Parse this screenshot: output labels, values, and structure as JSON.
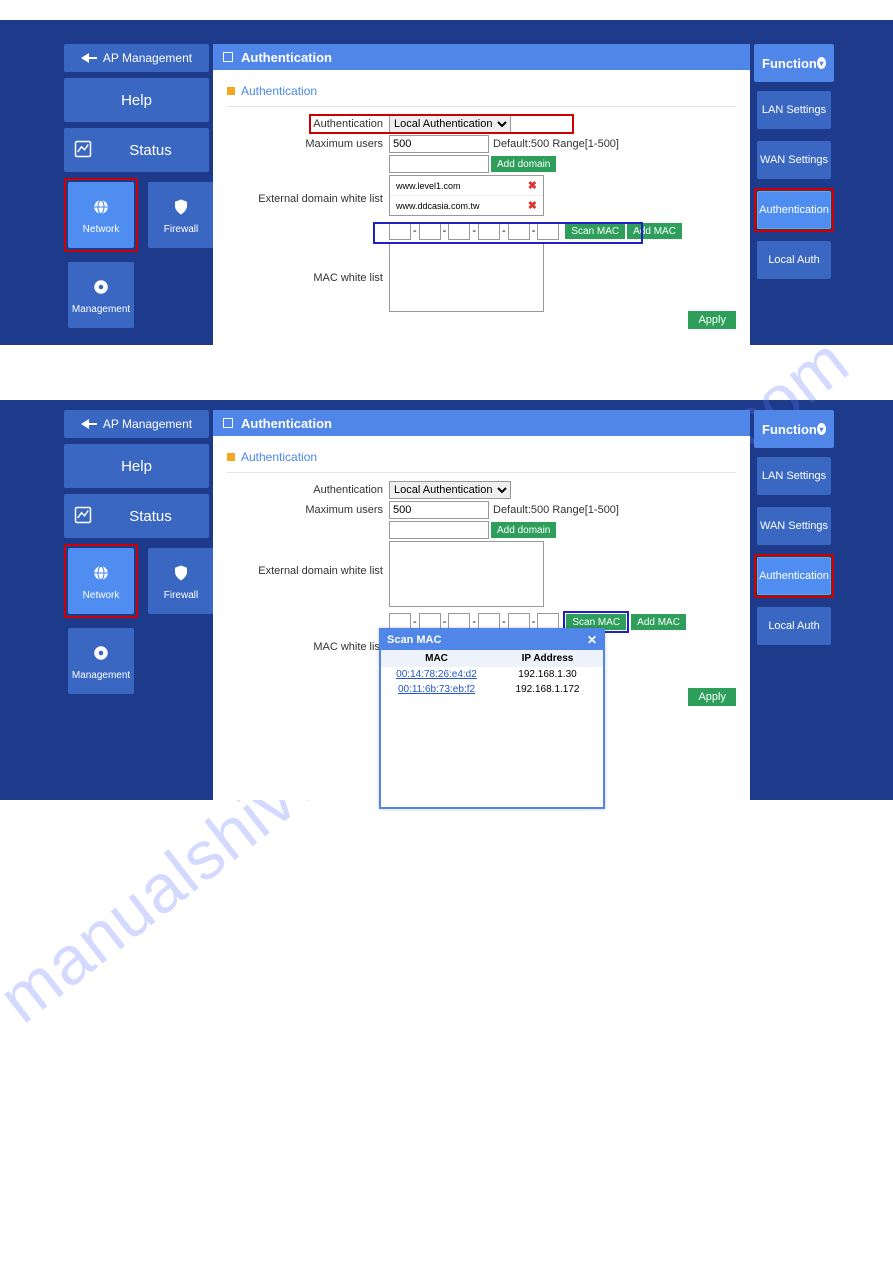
{
  "watermark": "manualshive.com",
  "left": {
    "ap_mgmt": "AP Management",
    "help": "Help",
    "status": "Status",
    "network": "Network",
    "firewall": "Firewall",
    "management": "Management"
  },
  "right": {
    "function": "Function",
    "lan": "LAN Settings",
    "wan": "WAN Settings",
    "auth": "Authentication",
    "local_auth": "Local Auth"
  },
  "title": "Authentication",
  "section": "Authentication",
  "form": {
    "lbl_auth": "Authentication",
    "sel_auth": "Local Authentication",
    "lbl_max": "Maximum users",
    "val_max": "500",
    "hint_max": "Default:500 Range[1-500]",
    "btn_add_domain": "Add domain",
    "lbl_whitelist": "External domain white list",
    "domain1": "www.level1.com",
    "domain2": "www.ddcasia.com.tw",
    "btn_scan": "Scan MAC",
    "btn_addmac": "Add MAC",
    "lbl_macwl": "MAC white list",
    "btn_apply": "Apply"
  },
  "popup": {
    "title": "Scan MAC",
    "col_mac": "MAC",
    "col_ip": "IP Address",
    "rows": [
      {
        "mac": "00:14:78:26:e4:d2",
        "ip": "192.168.1.30"
      },
      {
        "mac": "00:11:6b:73:eb:f2",
        "ip": "192.168.1.172"
      }
    ]
  }
}
